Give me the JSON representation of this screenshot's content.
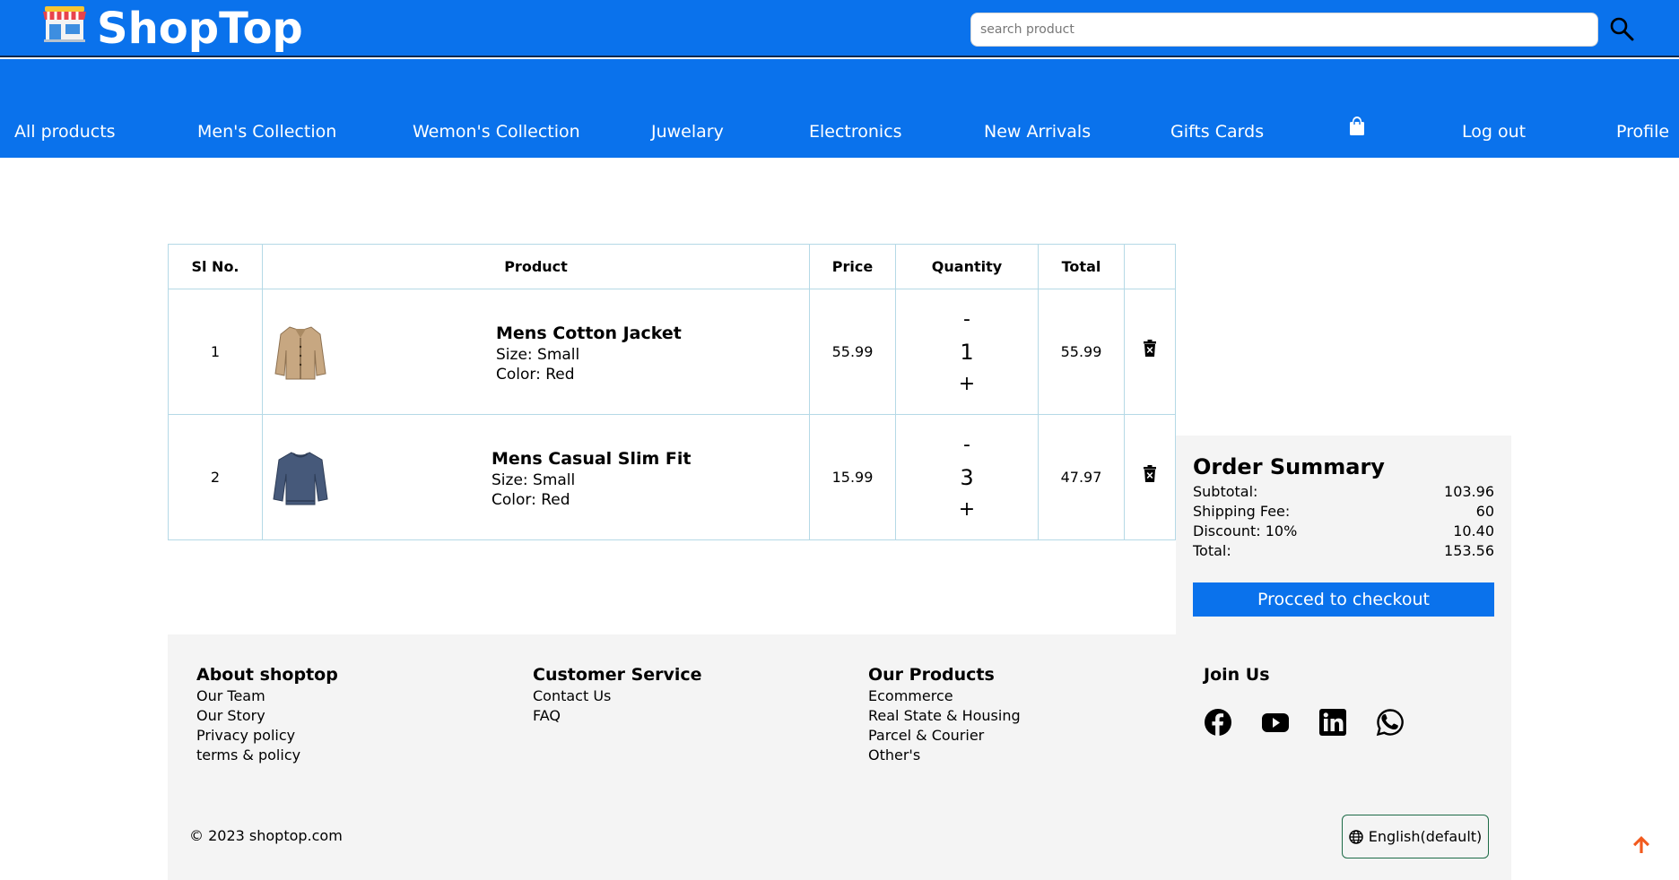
{
  "header": {
    "brand": "ShopTop",
    "search_placeholder": "search product"
  },
  "nav": {
    "items": [
      "All products",
      "Men's Collection",
      "Wemon's Collection",
      "Juwelary",
      "Electronics",
      "New Arrivals",
      "Gifts Cards",
      "Log out",
      "Profile"
    ]
  },
  "cart": {
    "headers": [
      "Sl No.",
      "Product",
      "Price",
      "Quantity",
      "Total",
      ""
    ],
    "rows": [
      {
        "sl": "1",
        "name": "Mens Cotton Jacket",
        "size": "Size: Small",
        "color": "Color: Red",
        "price": "55.99",
        "qty": "1",
        "total": "55.99",
        "minus": "-",
        "plus": "+"
      },
      {
        "sl": "2",
        "name": "Mens Casual Slim Fit",
        "size": "Size: Small",
        "color": "Color: Red",
        "price": "15.99",
        "qty": "3",
        "total": "47.97",
        "minus": "-",
        "plus": "+"
      }
    ]
  },
  "summary": {
    "title": "Order Summary",
    "subtotal_label": "Subtotal:",
    "subtotal": "103.96",
    "shipping_label": "Shipping Fee:",
    "shipping": "60",
    "discount_label": "Discount: 10%",
    "discount": "10.40",
    "total_label": "Total:",
    "total": "153.56",
    "checkout_label": "Procced to checkout"
  },
  "footer": {
    "about": {
      "title": "About shoptop",
      "links": [
        "Our Team",
        "Our Story",
        "Privacy policy",
        "terms & policy"
      ]
    },
    "service": {
      "title": "Customer Service",
      "links": [
        "Contact Us",
        "FAQ"
      ]
    },
    "products": {
      "title": "Our Products",
      "links": [
        "Ecommerce",
        "Real State & Housing",
        "Parcel & Courier",
        "Other's"
      ]
    },
    "join": {
      "title": "Join Us"
    },
    "copyright": "© 2023 shoptop.com",
    "language": "English(default)"
  },
  "colors": {
    "brand_blue": "#0a72ec",
    "panel_gray": "#f4f4f4",
    "table_border": "#b5d9e6",
    "scroll_top_orange": "#f25a1d"
  },
  "icons": [
    "store-logo-icon",
    "search-icon",
    "shopping-bag-icon",
    "trash-icon",
    "facebook-icon",
    "youtube-icon",
    "linkedin-icon",
    "whatsapp-icon",
    "globe-icon",
    "arrow-up-icon"
  ]
}
